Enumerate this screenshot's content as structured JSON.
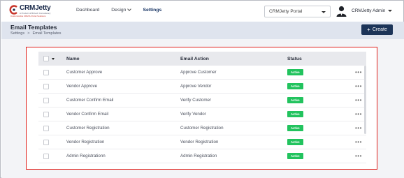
{
  "brand": {
    "name_part1": "CRM",
    "name_part2": "Jetty",
    "tagline": "A Product of Biztech Consultancy",
    "sub": "Customizable CRM & Portal Solutions"
  },
  "nav": {
    "items": [
      {
        "label": "Dashboard"
      },
      {
        "label": "Design"
      },
      {
        "label": "Settings"
      }
    ]
  },
  "portal_select": {
    "value": "CRMJetty Portal"
  },
  "user": {
    "name": "CRMJetty Admin"
  },
  "page": {
    "title": "Email Templates",
    "breadcrumb": [
      "Settings",
      "Email Templates"
    ],
    "breadcrumb_sep": ">",
    "create_label": "Create",
    "create_icon": "+"
  },
  "table": {
    "columns": [
      "Name",
      "Email Action",
      "Status"
    ],
    "rows": [
      {
        "name": "Customer Approve",
        "action": "Approve Customer",
        "status": "Active"
      },
      {
        "name": "Vendor Approve",
        "action": "Approve Vendor",
        "status": "Active"
      },
      {
        "name": "Customer Confirm Email",
        "action": "Verify Customer",
        "status": "Active"
      },
      {
        "name": "Vendor Confirm Email",
        "action": "Verify Vendor",
        "status": "Active"
      },
      {
        "name": "Customer Registration",
        "action": "Customer Registration",
        "status": "Active"
      },
      {
        "name": "Vendor Registration",
        "action": "Vendor Registration",
        "status": "Active"
      },
      {
        "name": "Admin Registrationn",
        "action": "Admin Registration",
        "status": "Active"
      }
    ],
    "more_glyph": "•••"
  },
  "colors": {
    "accent": "#1c3458",
    "active_badge": "#22c35e",
    "highlight_border": "#e0201b"
  }
}
